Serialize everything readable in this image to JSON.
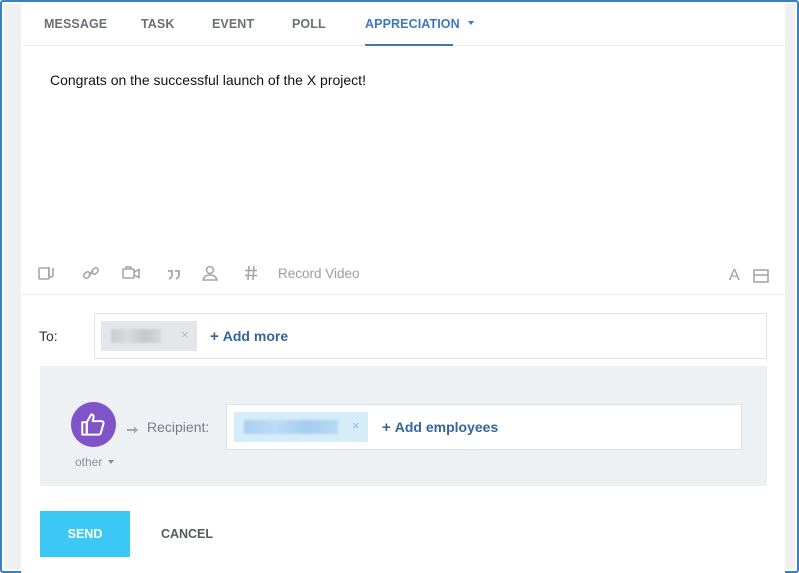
{
  "tabs": [
    {
      "label": "MESSAGE",
      "active": false
    },
    {
      "label": "TASK",
      "active": false
    },
    {
      "label": "EVENT",
      "active": false
    },
    {
      "label": "POLL",
      "active": false
    },
    {
      "label": "APPRECIATION",
      "active": true
    }
  ],
  "editor": {
    "text": "Congrats on the successful launch of the X project!"
  },
  "toolbar": {
    "icons": [
      "attach-file-icon",
      "link-icon",
      "video-camera-icon",
      "quote-icon",
      "mention-person-icon",
      "hashtag-icon"
    ],
    "record_video_label": "Record Video",
    "font_label": "A",
    "right_icon": "panel-toggle-icon"
  },
  "to_row": {
    "label": "To:",
    "chip_remove": "×",
    "add_more_label": "Add more",
    "add_plus": "+"
  },
  "recipient": {
    "badge_icon": "thumbs-up-icon",
    "badge_type": "other",
    "label": "Recipient:",
    "chip_remove": "×",
    "add_employees_label": "Add employees",
    "add_plus": "+"
  },
  "actions": {
    "send_label": "SEND",
    "cancel_label": "CANCEL"
  },
  "colors": {
    "accent": "#3e77c1",
    "send_button": "#3cc8f4",
    "badge": "#7f54c9",
    "frame_border": "#3b7fc4",
    "link": "#35649d"
  }
}
